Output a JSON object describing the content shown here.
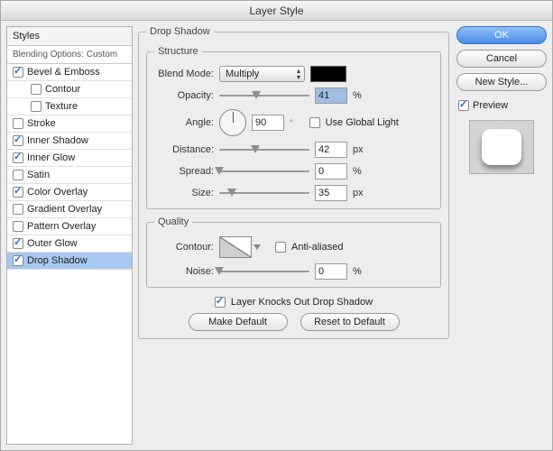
{
  "title": "Layer Style",
  "styles_panel": {
    "header": "Styles",
    "subheader": "Blending Options: Custom",
    "items": [
      {
        "label": "Bevel & Emboss",
        "checked": true,
        "indent": false
      },
      {
        "label": "Contour",
        "checked": false,
        "indent": true
      },
      {
        "label": "Texture",
        "checked": false,
        "indent": true
      },
      {
        "label": "Stroke",
        "checked": false,
        "indent": false
      },
      {
        "label": "Inner Shadow",
        "checked": true,
        "indent": false
      },
      {
        "label": "Inner Glow",
        "checked": true,
        "indent": false
      },
      {
        "label": "Satin",
        "checked": false,
        "indent": false
      },
      {
        "label": "Color Overlay",
        "checked": true,
        "indent": false
      },
      {
        "label": "Gradient Overlay",
        "checked": false,
        "indent": false
      },
      {
        "label": "Pattern Overlay",
        "checked": false,
        "indent": false
      },
      {
        "label": "Outer Glow",
        "checked": true,
        "indent": false
      },
      {
        "label": "Drop Shadow",
        "checked": true,
        "indent": false,
        "selected": true
      }
    ]
  },
  "drop_shadow": {
    "legend": "Drop Shadow",
    "structure": {
      "legend": "Structure",
      "blend_mode_label": "Blend Mode:",
      "blend_mode_value": "Multiply",
      "color": "#000000",
      "opacity_label": "Opacity:",
      "opacity_value": "41",
      "opacity_unit": "%",
      "opacity_pct": 41,
      "angle_label": "Angle:",
      "angle_value": "90",
      "angle_unit": "°",
      "use_global_light_label": "Use Global Light",
      "use_global_light": false,
      "distance_label": "Distance:",
      "distance_value": "42",
      "distance_unit": "px",
      "distance_pct": 40,
      "spread_label": "Spread:",
      "spread_value": "0",
      "spread_unit": "%",
      "spread_pct": 0,
      "size_label": "Size:",
      "size_value": "35",
      "size_unit": "px",
      "size_pct": 14
    },
    "quality": {
      "legend": "Quality",
      "contour_label": "Contour:",
      "antialiased_label": "Anti-aliased",
      "antialiased": false,
      "noise_label": "Noise:",
      "noise_value": "0",
      "noise_unit": "%",
      "noise_pct": 0
    },
    "knockout_label": "Layer Knocks Out Drop Shadow",
    "knockout": true,
    "make_default": "Make Default",
    "reset_default": "Reset to Default"
  },
  "side": {
    "ok": "OK",
    "cancel": "Cancel",
    "new_style": "New Style...",
    "preview_label": "Preview",
    "preview_checked": true
  }
}
